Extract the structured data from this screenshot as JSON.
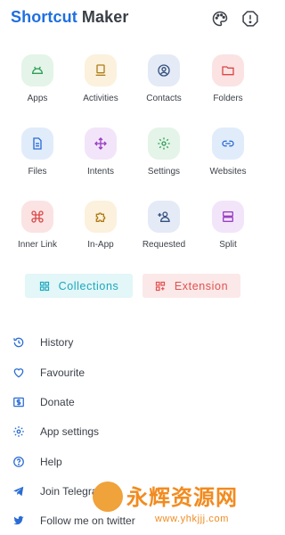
{
  "header": {
    "title_part1": "Shortcut",
    "title_part2": "Maker",
    "icons": [
      "palette-icon",
      "info-icon"
    ]
  },
  "grid": [
    {
      "label": "Apps",
      "icon": "android-icon",
      "bg": "#e4f4e8",
      "fg": "#2e9e57"
    },
    {
      "label": "Activities",
      "icon": "activity-icon",
      "bg": "#fbf1dc",
      "fg": "#b07d1a"
    },
    {
      "label": "Contacts",
      "icon": "contact-icon",
      "bg": "#e4eaf6",
      "fg": "#33507e"
    },
    {
      "label": "Folders",
      "icon": "folder-icon",
      "bg": "#fbe3e3",
      "fg": "#d94848"
    },
    {
      "label": "Files",
      "icon": "file-icon",
      "bg": "#e1ecfb",
      "fg": "#2a6cd4"
    },
    {
      "label": "Intents",
      "icon": "intent-icon",
      "bg": "#f2e5f9",
      "fg": "#9a3fc4"
    },
    {
      "label": "Settings",
      "icon": "gear-icon",
      "bg": "#e4f4e8",
      "fg": "#2e9e57"
    },
    {
      "label": "Websites",
      "icon": "link-icon",
      "bg": "#e1ecfb",
      "fg": "#2a6cd4"
    },
    {
      "label": "Inner Link",
      "icon": "command-icon",
      "bg": "#fbe3e3",
      "fg": "#d94848"
    },
    {
      "label": "In-App",
      "icon": "puzzle-icon",
      "bg": "#fbf1dc",
      "fg": "#b07d1a"
    },
    {
      "label": "Requested",
      "icon": "person-add-icon",
      "bg": "#e4eaf6",
      "fg": "#33507e"
    },
    {
      "label": "Split",
      "icon": "split-icon",
      "bg": "#f2e5f9",
      "fg": "#9a3fc4"
    }
  ],
  "chips": {
    "collections": "Collections",
    "extension": "Extension"
  },
  "menu": [
    {
      "label": "History",
      "icon": "history-icon"
    },
    {
      "label": "Favourite",
      "icon": "heart-icon"
    },
    {
      "label": "Donate",
      "icon": "dollar-icon"
    },
    {
      "label": "App settings",
      "icon": "gear-icon"
    },
    {
      "label": "Help",
      "icon": "help-icon"
    },
    {
      "label": "Join Telegram",
      "icon": "telegram-icon"
    },
    {
      "label": "Follow me on twitter",
      "icon": "twitter-icon"
    }
  ],
  "watermark": {
    "cn_text": "永辉资源网",
    "url": "www.yhkjjj.com"
  },
  "colors": {
    "brand_blue": "#1f6fe0",
    "cyan": "#1aa8bd",
    "red": "#e0514f",
    "icon_blue": "#2a6cd4"
  }
}
